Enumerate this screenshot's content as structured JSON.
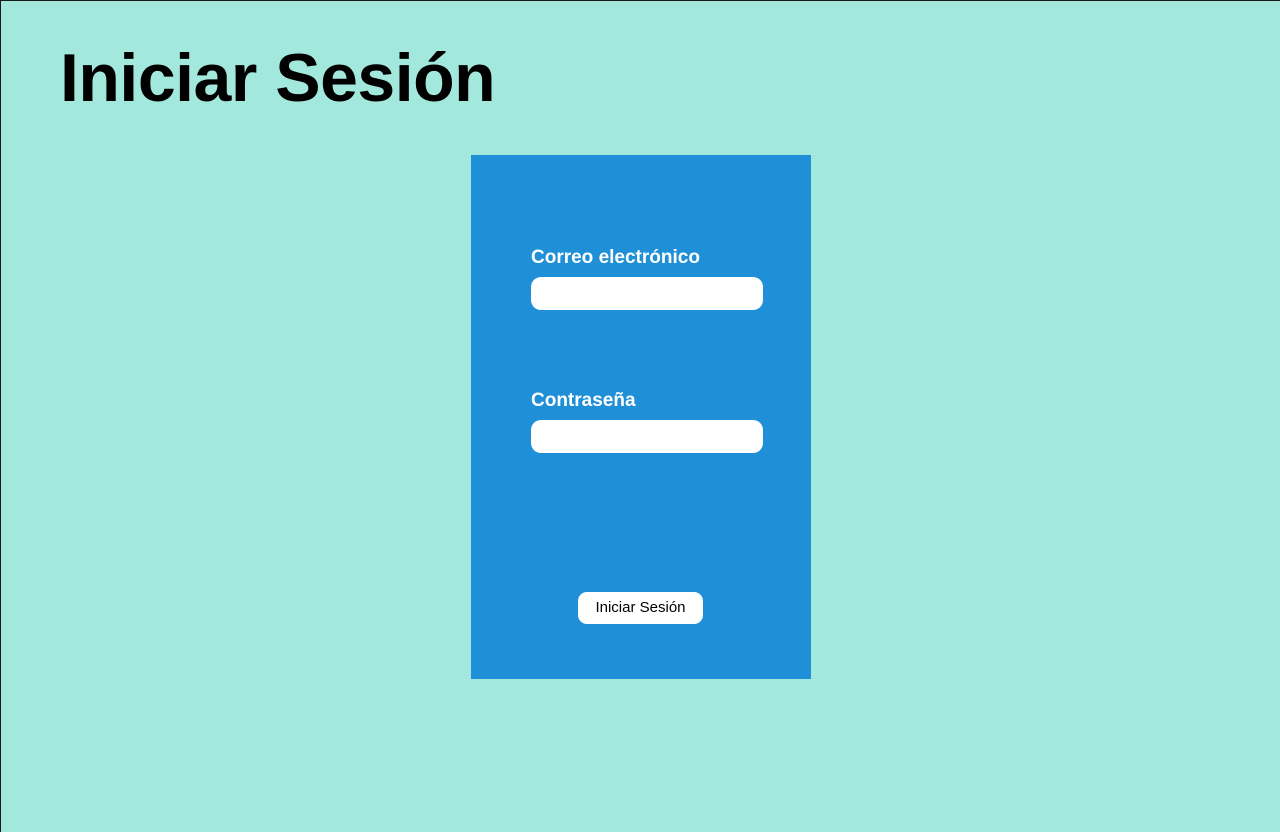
{
  "page": {
    "title": "Iniciar Sesión"
  },
  "login_form": {
    "email_label": "Correo electrónico",
    "email_value": "",
    "password_label": "Contraseña",
    "password_value": "",
    "submit_label": "Iniciar Sesión"
  },
  "colors": {
    "background": "#a3e8dd",
    "card": "#1f8fd7",
    "input_background": "#ffffff",
    "label_text": "#ffffff",
    "title_text": "#000000"
  }
}
